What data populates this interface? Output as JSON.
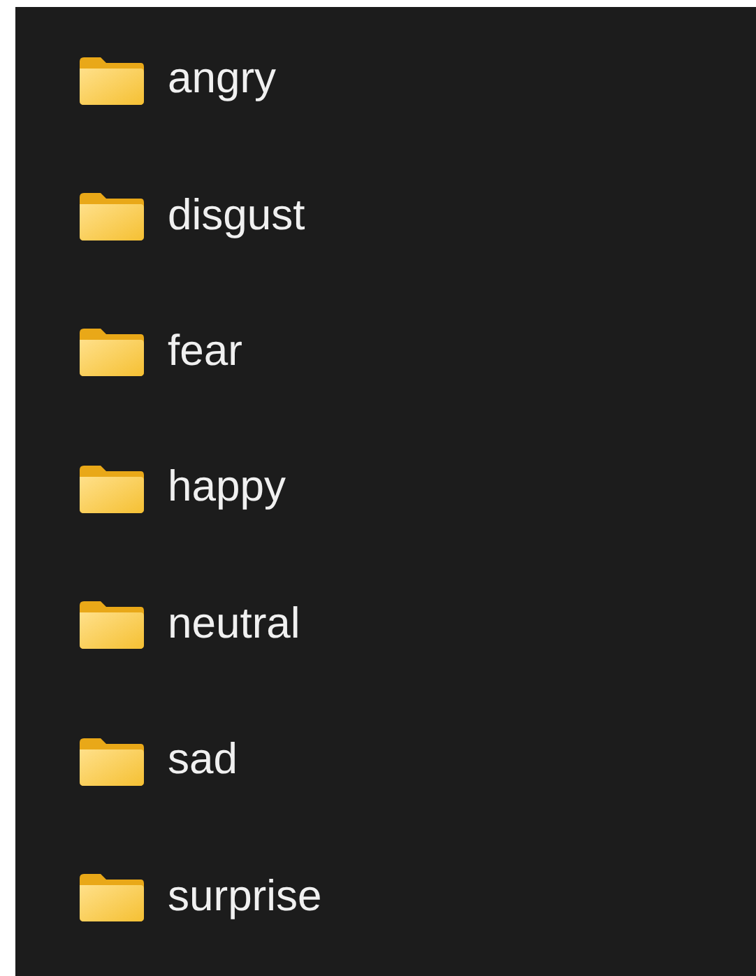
{
  "folders": [
    {
      "name": "angry"
    },
    {
      "name": "disgust"
    },
    {
      "name": "fear"
    },
    {
      "name": "happy"
    },
    {
      "name": "neutral"
    },
    {
      "name": "sad"
    },
    {
      "name": "surprise"
    }
  ]
}
